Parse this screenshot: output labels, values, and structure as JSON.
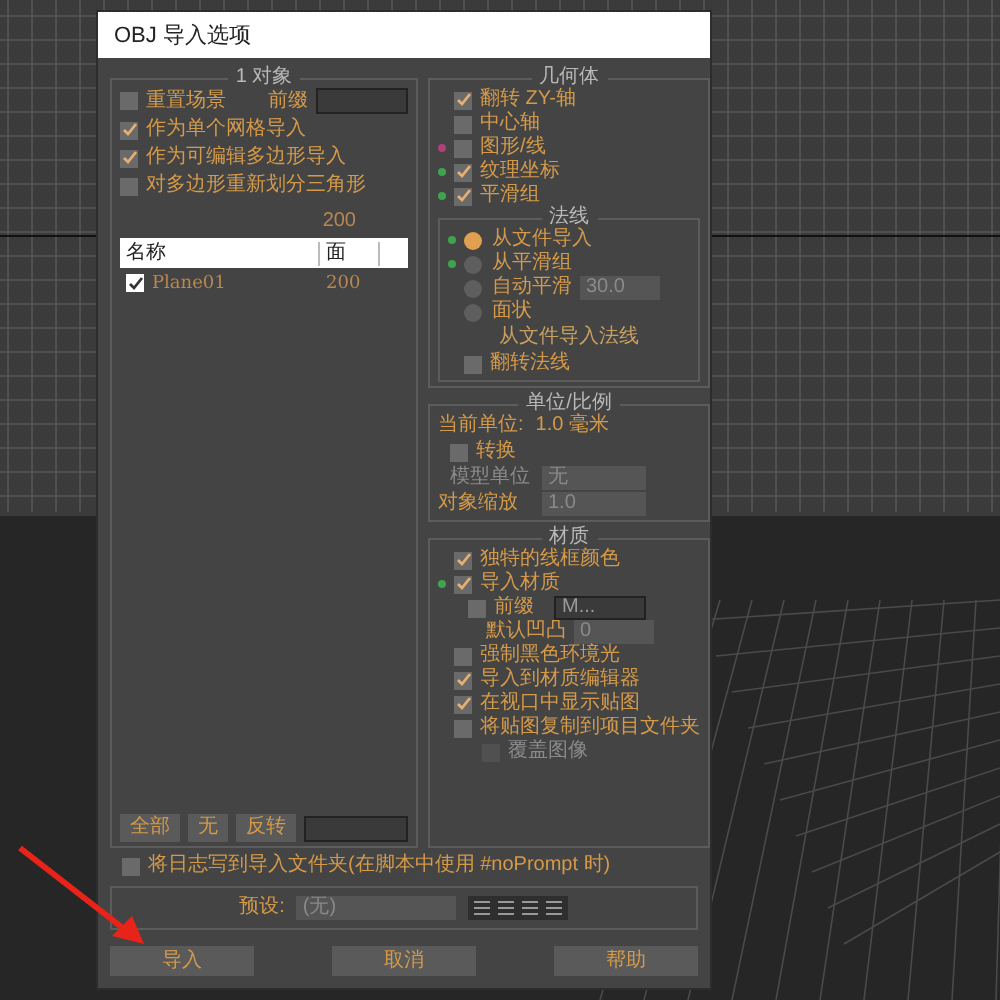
{
  "window": {
    "title": "OBJ 导入选项"
  },
  "objects": {
    "title": "1 对象",
    "options": [
      {
        "label": "重置场景",
        "checked": false
      },
      {
        "label": "作为单个网格导入",
        "checked": true
      },
      {
        "label": "作为可编辑多边形导入",
        "checked": true
      },
      {
        "label": "对多边形重新划分三角形",
        "checked": false
      }
    ],
    "prefix_label": "前缀",
    "face_total": "200",
    "table": {
      "columns": [
        "名称",
        "面"
      ],
      "rows": [
        {
          "name": "Plane01",
          "faces": "200",
          "checked": true
        }
      ]
    },
    "buttons": [
      "全部",
      "无",
      "反转"
    ]
  },
  "log_option": {
    "label": "将日志写到导入文件夹(在脚本中使用 #noPrompt 时)",
    "checked": false
  },
  "preset": {
    "label": "预设:",
    "value": "(无)"
  },
  "actions": [
    "导入",
    "取消",
    "帮助"
  ],
  "geometry": {
    "title": "几何体",
    "options": [
      {
        "label": "翻转 ZY-轴",
        "checked": true
      },
      {
        "label": "中心轴",
        "checked": false
      },
      {
        "label": "图形/线",
        "checked": false,
        "color": "#b0407a"
      },
      {
        "label": "纹理坐标",
        "checked": true,
        "color": "#3fa34d"
      },
      {
        "label": "平滑组",
        "checked": true,
        "color": "#3fa34d"
      }
    ]
  },
  "normals": {
    "title": "法线",
    "options": [
      {
        "label": "从文件导入",
        "selected": true,
        "color": "#3fa34d"
      },
      {
        "label": "从平滑组",
        "selected": false,
        "color": "#3fa34d"
      },
      {
        "label": "自动平滑",
        "selected": false,
        "value": "30.0"
      },
      {
        "label": "面状",
        "selected": false
      }
    ],
    "note": "从文件导入法线",
    "flip": {
      "label": "翻转法线",
      "checked": false
    }
  },
  "units": {
    "title": "单位/比例",
    "current_label": "当前单位:",
    "current_value": "1.0 毫米",
    "convert": {
      "label": "转换",
      "checked": false
    },
    "model_unit": {
      "label": "模型单位",
      "value": "无"
    },
    "scale": {
      "label": "对象缩放",
      "value": "1.0"
    }
  },
  "materials": {
    "title": "材质",
    "options": [
      {
        "kind": "check",
        "label": "独特的线框颜色",
        "checked": true
      },
      {
        "kind": "check",
        "label": "导入材质",
        "checked": true,
        "color": "#3fa34d"
      },
      {
        "kind": "prefix",
        "label": "前缀",
        "checked": false,
        "value": "M..."
      },
      {
        "kind": "spinner",
        "label": "默认凹凸",
        "value": "0"
      },
      {
        "kind": "check",
        "label": "强制黑色环境光",
        "checked": false
      },
      {
        "kind": "check",
        "label": "导入到材质编辑器",
        "checked": true
      },
      {
        "kind": "check",
        "label": "在视口中显示贴图",
        "checked": true
      },
      {
        "kind": "check",
        "label": "将贴图复制到项目文件夹",
        "checked": false
      },
      {
        "kind": "subcheck",
        "label": "覆盖图像",
        "checked": false,
        "disabled": true
      }
    ]
  }
}
